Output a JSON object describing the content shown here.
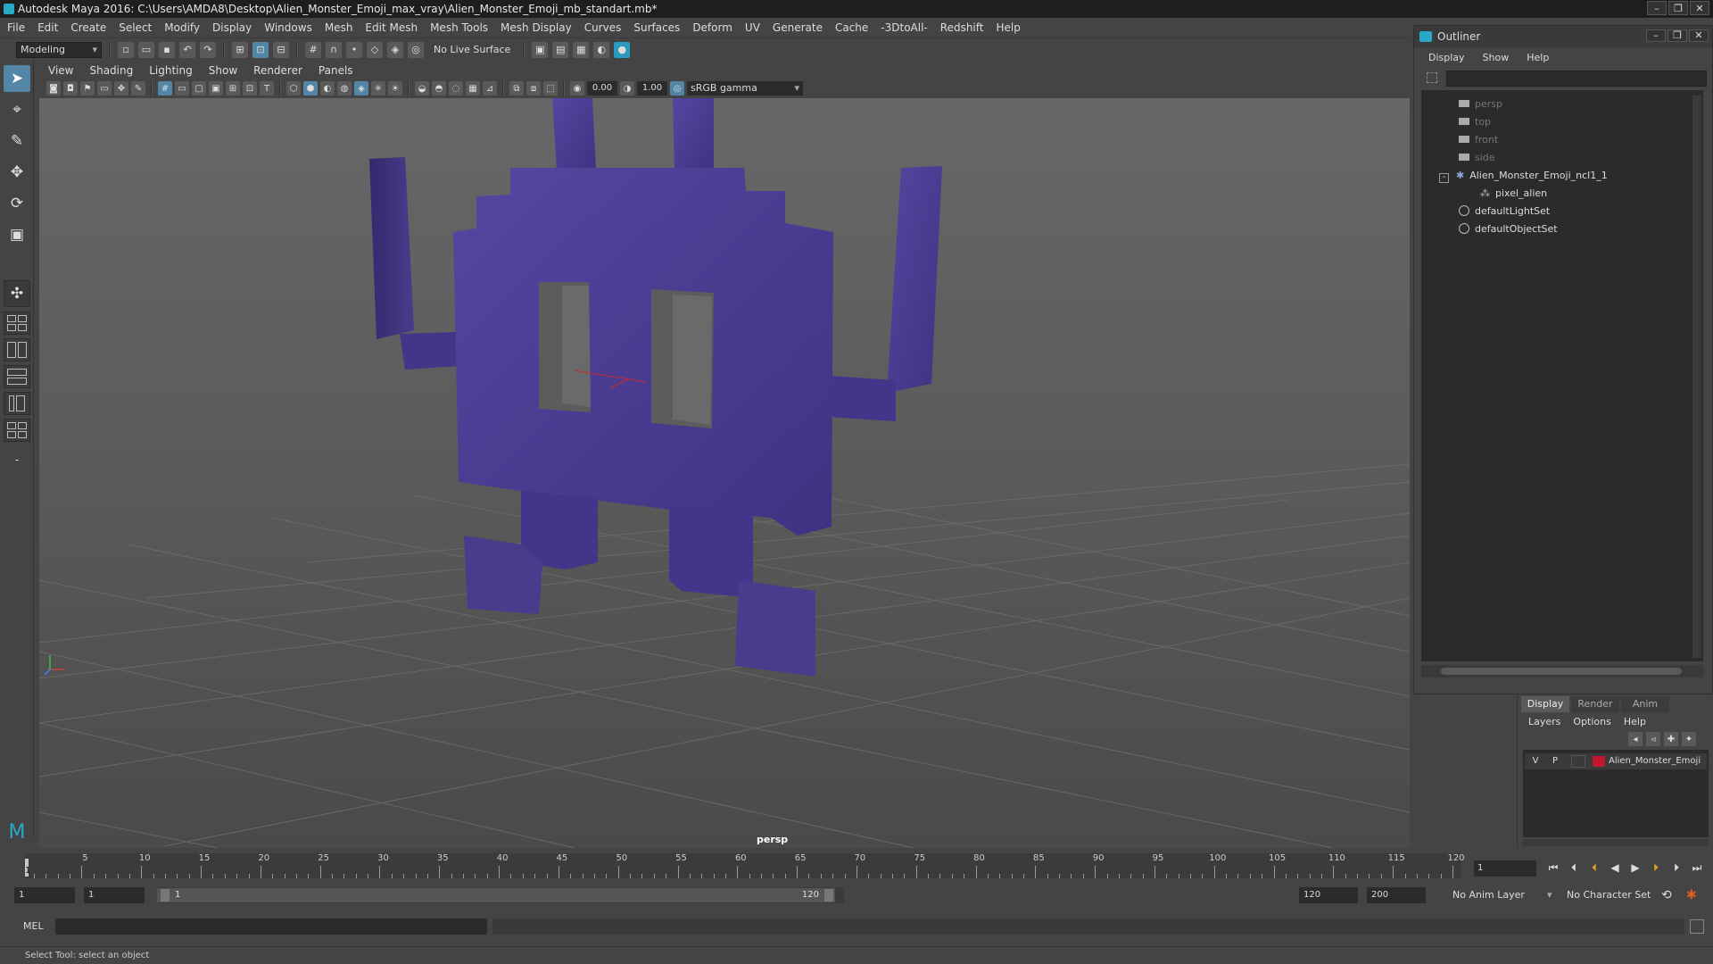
{
  "window": {
    "title": "Autodesk Maya 2016: C:\\Users\\AMDA8\\Desktop\\Alien_Monster_Emoji_max_vray\\Alien_Monster_Emoji_mb_standart.mb*"
  },
  "menubar": [
    "File",
    "Edit",
    "Create",
    "Select",
    "Modify",
    "Display",
    "Windows",
    "Mesh",
    "Edit Mesh",
    "Mesh Tools",
    "Mesh Display",
    "Curves",
    "Surfaces",
    "Deform",
    "UV",
    "Generate",
    "Cache",
    "-3DtoAll-",
    "Redshift",
    "Help"
  ],
  "statusline": {
    "menuset": "Modeling",
    "live_surface": "No Live Surface"
  },
  "panel": {
    "menus": [
      "View",
      "Shading",
      "Lighting",
      "Show",
      "Renderer",
      "Panels"
    ],
    "exposure": "0.00",
    "gamma_value": "1.00",
    "color_space": "sRGB gamma",
    "camera_label": "persp"
  },
  "outliner": {
    "title": "Outliner",
    "menus": [
      "Display",
      "Show",
      "Help"
    ],
    "items": [
      "persp",
      "top",
      "front",
      "side",
      "Alien_Monster_Emoji_ncl1_1",
      "pixel_alien",
      "defaultLightSet",
      "defaultObjectSet"
    ]
  },
  "layer_editor": {
    "tabs": [
      "Display",
      "Render",
      "Anim"
    ],
    "menus": [
      "Layers",
      "Options",
      "Help"
    ],
    "layer": {
      "visible": "V",
      "playback": "P",
      "name": "Alien_Monster_Emoji",
      "color": "#c01830"
    }
  },
  "timeline": {
    "start": 1,
    "end": 120,
    "tick_labels": [
      "5",
      "10",
      "15",
      "20",
      "25",
      "30",
      "35",
      "40",
      "45",
      "50",
      "55",
      "60",
      "65",
      "70",
      "75",
      "80",
      "85",
      "90",
      "95",
      "100",
      "105",
      "110",
      "115",
      "120"
    ],
    "current_frame_marker": "1",
    "current_frame_field": "1"
  },
  "range": {
    "start_field": "1",
    "start_field2": "1",
    "slider_start": "1",
    "slider_end": "120",
    "end_field": "120",
    "max_field": "200",
    "anim_layer": "No Anim Layer",
    "character_set": "No Character Set"
  },
  "command": {
    "label": "MEL"
  },
  "help": {
    "text": "Select Tool: select an object"
  },
  "colors": {
    "model": "#4a3b8c",
    "accent": "#5285a6"
  }
}
